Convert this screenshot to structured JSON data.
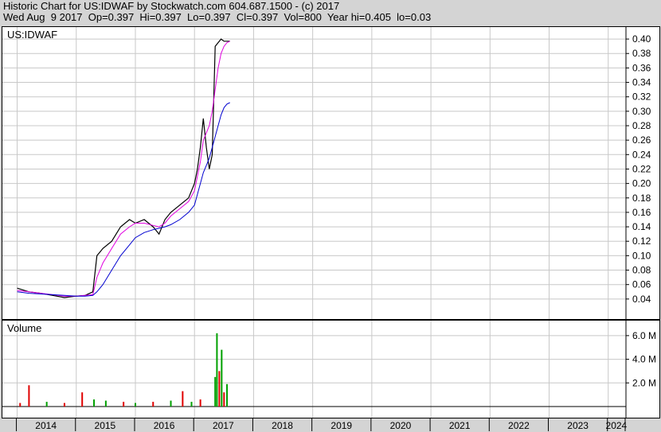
{
  "header": {
    "line1": "Historic Chart for US:IDWAF by Stockwatch.com 604.687.1500 - (c) 2017",
    "line2": "Wed Aug  9 2017  Op=0.397  Hi=0.397  Lo=0.397  Cl=0.397  Vol=800  Year hi=0.405  lo=0.03"
  },
  "chart_data": {
    "type": "line",
    "price_panel": {
      "label": "US:IDWAF",
      "ylim": [
        0.02,
        0.41
      ],
      "y_ticks": [
        0.04,
        0.06,
        0.08,
        0.1,
        0.12,
        0.14,
        0.16,
        0.18,
        0.2,
        0.22,
        0.24,
        0.26,
        0.28,
        0.3,
        0.32,
        0.34,
        0.36,
        0.38,
        0.4
      ],
      "x": [
        2014.0,
        2014.2,
        2014.4,
        2014.6,
        2014.8,
        2015.0,
        2015.15,
        2015.28,
        2015.35,
        2015.45,
        2015.6,
        2015.75,
        2015.9,
        2016.0,
        2016.15,
        2016.3,
        2016.4,
        2016.5,
        2016.6,
        2016.75,
        2016.9,
        2017.0,
        2017.05,
        2017.1,
        2017.15,
        2017.2,
        2017.25,
        2017.3,
        2017.35,
        2017.4,
        2017.45,
        2017.5,
        2017.55,
        2017.6
      ],
      "series": [
        {
          "name": "",
          "color": "#000000",
          "values": [
            0.055,
            0.05,
            0.048,
            0.045,
            0.042,
            0.044,
            0.045,
            0.05,
            0.1,
            0.11,
            0.12,
            0.14,
            0.15,
            0.145,
            0.15,
            0.14,
            0.13,
            0.15,
            0.16,
            0.17,
            0.18,
            0.2,
            0.22,
            0.25,
            0.29,
            0.25,
            0.22,
            0.24,
            0.39,
            0.395,
            0.4,
            0.397,
            0.397,
            0.397
          ]
        },
        {
          "name": "",
          "color": "#e000e0",
          "values": [
            0.052,
            0.05,
            0.048,
            0.046,
            0.044,
            0.044,
            0.045,
            0.046,
            0.07,
            0.09,
            0.11,
            0.13,
            0.14,
            0.145,
            0.145,
            0.142,
            0.14,
            0.145,
            0.155,
            0.165,
            0.175,
            0.19,
            0.21,
            0.23,
            0.26,
            0.27,
            0.28,
            0.3,
            0.33,
            0.36,
            0.38,
            0.39,
            0.395,
            0.397
          ]
        },
        {
          "name": "",
          "color": "#0000d0",
          "values": [
            0.05,
            0.048,
            0.047,
            0.046,
            0.045,
            0.044,
            0.044,
            0.045,
            0.05,
            0.06,
            0.08,
            0.1,
            0.115,
            0.125,
            0.132,
            0.136,
            0.138,
            0.14,
            0.143,
            0.15,
            0.16,
            0.17,
            0.185,
            0.2,
            0.215,
            0.225,
            0.235,
            0.25,
            0.265,
            0.28,
            0.295,
            0.305,
            0.31,
            0.312
          ]
        }
      ]
    },
    "volume_panel": {
      "label": "Volume",
      "ylim": [
        0,
        7000000
      ],
      "y_ticks": [
        {
          "value": 2000000,
          "label": "2.0 M"
        },
        {
          "value": 4000000,
          "label": "4.0 M"
        },
        {
          "value": 6000000,
          "label": "6.0 M"
        }
      ],
      "x": [
        2014.05,
        2014.2,
        2014.5,
        2014.8,
        2015.1,
        2015.3,
        2015.5,
        2015.8,
        2016.0,
        2016.3,
        2016.6,
        2016.8,
        2016.95,
        2017.1,
        2017.35,
        2017.38,
        2017.42,
        2017.46,
        2017.5,
        2017.55
      ],
      "values": [
        300000,
        1800000,
        400000,
        300000,
        1200000,
        600000,
        500000,
        400000,
        300000,
        400000,
        500000,
        1300000,
        400000,
        600000,
        2500000,
        6200000,
        3000000,
        4800000,
        1200000,
        1900000
      ],
      "colors": [
        "#e00000",
        "#e00000",
        "#00a000",
        "#e00000",
        "#e00000",
        "#00a000",
        "#00a000",
        "#e00000",
        "#00a000",
        "#e00000",
        "#00a000",
        "#e00000",
        "#00a000",
        "#e00000",
        "#00a000",
        "#00a000",
        "#e00000",
        "#00a000",
        "#e00000",
        "#00a000"
      ]
    },
    "x_axis": {
      "xlim": [
        2013.75,
        2024.3
      ],
      "tick_labels": [
        "2014",
        "2015",
        "2016",
        "2017",
        "2018",
        "2019",
        "2020",
        "2021",
        "2022",
        "2023",
        "2024"
      ]
    },
    "grid": true
  }
}
